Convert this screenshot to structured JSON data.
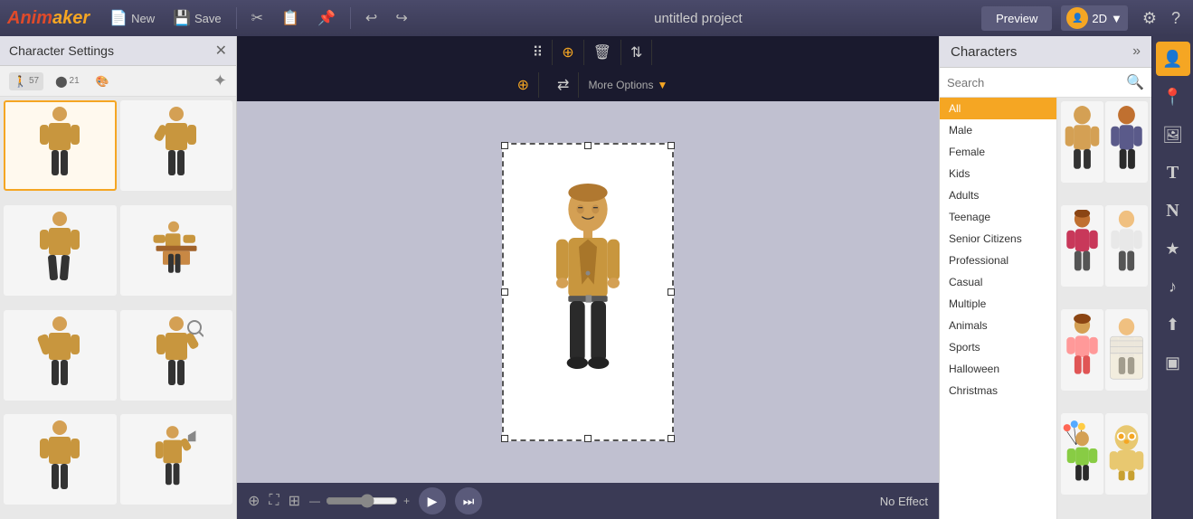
{
  "app": {
    "logo": "Animaker",
    "project_title": "untitled project",
    "preview_label": "Preview",
    "mode": "2D",
    "toolbar": {
      "new_label": "New",
      "save_label": "Save"
    }
  },
  "left_panel": {
    "title": "Character Settings",
    "tab_poses_count": "57",
    "tab_props_count": "21"
  },
  "canvas": {
    "more_options_label": "More Options",
    "effect_label": "No Effect"
  },
  "characters_panel": {
    "title": "Characters",
    "search_placeholder": "Search",
    "categories": [
      {
        "id": "all",
        "label": "All",
        "active": true
      },
      {
        "id": "male",
        "label": "Male"
      },
      {
        "id": "female",
        "label": "Female"
      },
      {
        "id": "kids",
        "label": "Kids"
      },
      {
        "id": "adults",
        "label": "Adults"
      },
      {
        "id": "teenage",
        "label": "Teenage"
      },
      {
        "id": "senior",
        "label": "Senior Citizens"
      },
      {
        "id": "professional",
        "label": "Professional"
      },
      {
        "id": "casual",
        "label": "Casual"
      },
      {
        "id": "multiple",
        "label": "Multiple"
      },
      {
        "id": "animals",
        "label": "Animals"
      },
      {
        "id": "sports",
        "label": "Sports"
      },
      {
        "id": "halloween",
        "label": "Halloween"
      },
      {
        "id": "christmas",
        "label": "Christmas"
      }
    ]
  },
  "right_sidebar": {
    "icons": [
      {
        "id": "character",
        "symbol": "👤",
        "active": true
      },
      {
        "id": "location",
        "symbol": "📍"
      },
      {
        "id": "image",
        "symbol": "🖼"
      },
      {
        "id": "text-t",
        "symbol": "T"
      },
      {
        "id": "text-n",
        "symbol": "N"
      },
      {
        "id": "star",
        "symbol": "★"
      },
      {
        "id": "music",
        "symbol": "♪"
      },
      {
        "id": "upload",
        "symbol": "⬆"
      },
      {
        "id": "scene",
        "symbol": "▣"
      }
    ]
  }
}
